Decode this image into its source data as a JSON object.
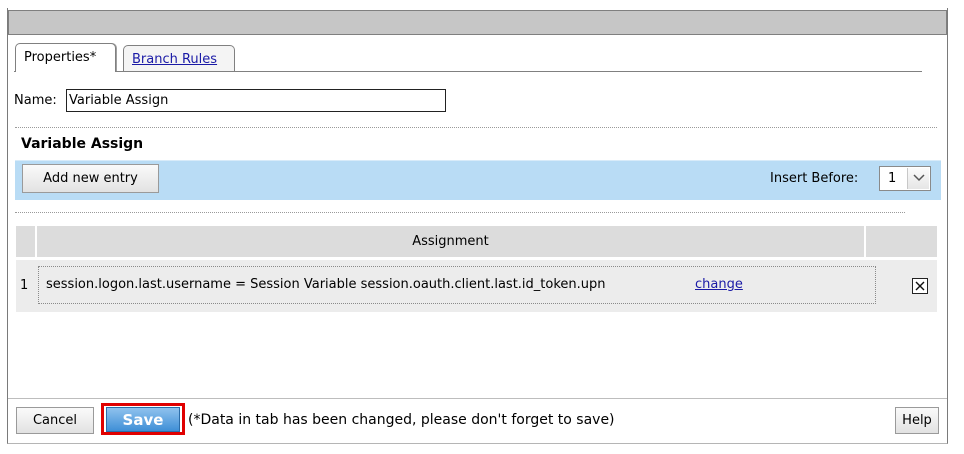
{
  "tabs": [
    {
      "label": "Properties*",
      "active": true
    },
    {
      "label": "Branch Rules",
      "active": false
    }
  ],
  "name_field": {
    "label": "Name:",
    "value": "Variable Assign"
  },
  "section_title": "Variable Assign",
  "toolbar": {
    "add_label": "Add new entry",
    "insert_before_label": "Insert Before:",
    "insert_before_value": "1"
  },
  "table": {
    "headers": [
      "",
      "Assignment",
      ""
    ],
    "rows": [
      {
        "index": "1",
        "assignment": "session.logon.last.username = Session Variable session.oauth.client.last.id_token.upn",
        "change_label": "change"
      }
    ]
  },
  "footer": {
    "cancel_label": "Cancel",
    "save_label": "Save",
    "save_note": "(*Data in tab has been changed, please don't forget to save)",
    "help_label": "Help"
  },
  "colors": {
    "toolbar_bg": "#b9dcf5",
    "save_button": "#3f8fd6",
    "highlight_outline": "#e00000",
    "link": "#1a1aa6"
  },
  "icons": [
    "chevron-down-icon",
    "close-x-icon"
  ]
}
